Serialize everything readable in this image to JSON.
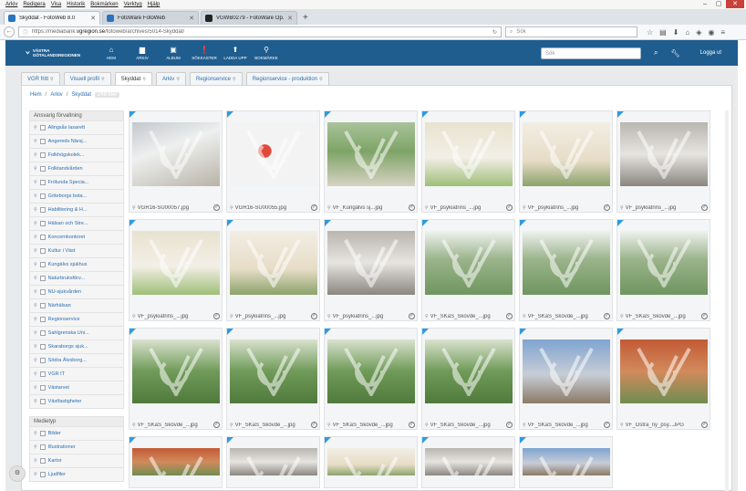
{
  "browser": {
    "menu": [
      "Arkiv",
      "Redigera",
      "Visa",
      "Historik",
      "Bokmärken",
      "Verktyg",
      "Hjälp"
    ],
    "tabs": [
      {
        "label": "Skyddat - FotoWeb 8.0",
        "active": true
      },
      {
        "label": "FotoWare FotoWeb",
        "active": false
      },
      {
        "label": "VGWB0279 - FotoWare Op...",
        "active": false
      }
    ],
    "url_prefix": "https://mediabank.",
    "url_domain": "vgregion.se",
    "url_suffix": "/fotoweb/archives/5014-Skyddat/",
    "search_placeholder": "Sök"
  },
  "app": {
    "logo_line1": "VÄSTRA",
    "logo_line2": "GÖTALANDSREGIONEN",
    "nav": [
      {
        "label": "Hem",
        "icon": "home-icon"
      },
      {
        "label": "Arkiv",
        "icon": "folder-icon"
      },
      {
        "label": "Album",
        "icon": "album-icon"
      },
      {
        "label": "Sökkaster",
        "icon": "alert-icon"
      },
      {
        "label": "Ladda upp",
        "icon": "upload-icon"
      },
      {
        "label": "Bokmärke",
        "icon": "pin-icon"
      }
    ],
    "search_placeholder": "Sök",
    "logout": "Logga ut"
  },
  "subtabs": [
    {
      "label": "VGR fritt",
      "active": false
    },
    {
      "label": "Visuell profil",
      "active": false
    },
    {
      "label": "Skyddat",
      "active": true
    },
    {
      "label": "Arkiv",
      "active": false
    },
    {
      "label": "Regionservice",
      "active": false
    },
    {
      "label": "Regionservice - produktion",
      "active": false
    }
  ],
  "breadcrumb": {
    "items": [
      "Hem",
      "Arkiv",
      "Skyddat"
    ],
    "count": "248 filer"
  },
  "filters": [
    {
      "title": "Ansvarig förvaltning",
      "items": [
        "Alingsås lasarett",
        "Angereds Närsj...",
        "Folkhögskolek...",
        "Folktandvården",
        "Frölunda Specia...",
        "Göteborgs bota...",
        "Habilitering & H...",
        "Hälsan och Stre...",
        "Koncernkontoret",
        "Kultur i Väst",
        "Kungälvs sjukhus",
        "Naturbruksförv...",
        "NU-sjukvården",
        "Närhälsan",
        "Regionservice",
        "Sahlgrenska Uni...",
        "Skaraborgs sjuk...",
        "Södra Älvsborg...",
        "VGR IT",
        "Västarvet",
        "Västfastigheter"
      ]
    },
    {
      "title": "Medietyp",
      "items": [
        "Bilder",
        "Illustrationer",
        "Kartor",
        "Ljudfiler"
      ]
    }
  ],
  "assets": [
    {
      "name": "VGR16-SU00057.jpg",
      "style": "room1"
    },
    {
      "name": "VGR16-SU00055.jpg",
      "style": "white"
    },
    {
      "name": "VF_Kungälvs sj...jpg",
      "style": "aerial"
    },
    {
      "name": "VF_psykiatrins_...jpg",
      "style": "interior"
    },
    {
      "name": "VF_psykiatrins_...jpg",
      "style": "lobby"
    },
    {
      "name": "VF_psykiatrins_...jpg",
      "style": "office"
    },
    {
      "name": "VF_psykiatrins_...jpg",
      "style": "interior"
    },
    {
      "name": "VF_psykiatrins_...jpg",
      "style": "lobby"
    },
    {
      "name": "VF_psykiatrins_...jpg",
      "style": "office"
    },
    {
      "name": "VF_SKaS_Skövde_...jpg",
      "style": "model"
    },
    {
      "name": "VF_SKaS_Skövde_...jpg",
      "style": "model"
    },
    {
      "name": "VF_SKaS_Skövde_...jpg",
      "style": "model"
    },
    {
      "name": "VF_SKaS_Skövde_...jpg",
      "style": "green"
    },
    {
      "name": "VF_SKaS_Skövde_...jpg",
      "style": "green"
    },
    {
      "name": "VF_SKaS_Skövde_...jpg",
      "style": "green"
    },
    {
      "name": "VF_SKaS_Skövde_...jpg",
      "style": "green"
    },
    {
      "name": "VF_SKaS_Skövde_...jpg",
      "style": "ward"
    },
    {
      "name": "VF_Östra_ny_psy...JPG",
      "style": "brick"
    },
    {
      "name": "",
      "style": "brick",
      "partial": true
    },
    {
      "name": "",
      "style": "office",
      "partial": true
    },
    {
      "name": "",
      "style": "lobby",
      "partial": true
    },
    {
      "name": "",
      "style": "office",
      "partial": true
    },
    {
      "name": "",
      "style": "ward",
      "partial": true
    }
  ]
}
